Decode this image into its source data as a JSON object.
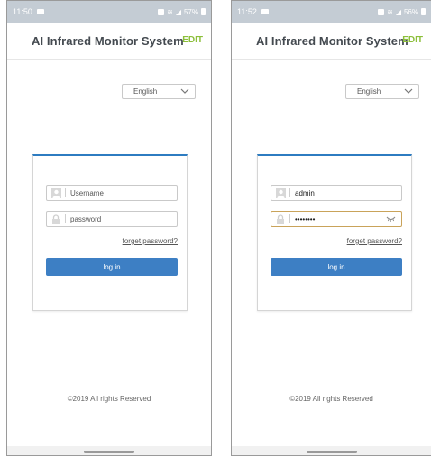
{
  "screens": [
    {
      "status": {
        "time": "11:50",
        "battery": "57%"
      },
      "app": {
        "title": "AI Infrared Monitor System",
        "edit_label": "EDIT"
      },
      "language": {
        "selected": "English"
      },
      "login": {
        "username_placeholder": "Username",
        "password_placeholder": "password",
        "username_value": "",
        "password_value": "",
        "forget_label": "forget password?",
        "login_label": "log in"
      },
      "footer": "©2019 All rights Reserved"
    },
    {
      "status": {
        "time": "11:52",
        "battery": "56%"
      },
      "app": {
        "title": "AI Infrared Monitor System",
        "edit_label": "EDIT"
      },
      "language": {
        "selected": "English"
      },
      "login": {
        "username_value": "admin",
        "password_value": "••••••••",
        "forget_label": "forget password?",
        "login_label": "log in"
      },
      "footer": "©2019 All rights Reserved"
    }
  ],
  "icons": {
    "user": "user-icon",
    "lock": "lock-icon",
    "chevron": "chevron-down-icon",
    "eye": "eye-icon"
  },
  "colors": {
    "accent": "#3d7fc4",
    "card_top": "#2d7cc1",
    "edit": "#8cbf3a",
    "statusbar": "#c4ccd4",
    "title": "#444a50"
  }
}
